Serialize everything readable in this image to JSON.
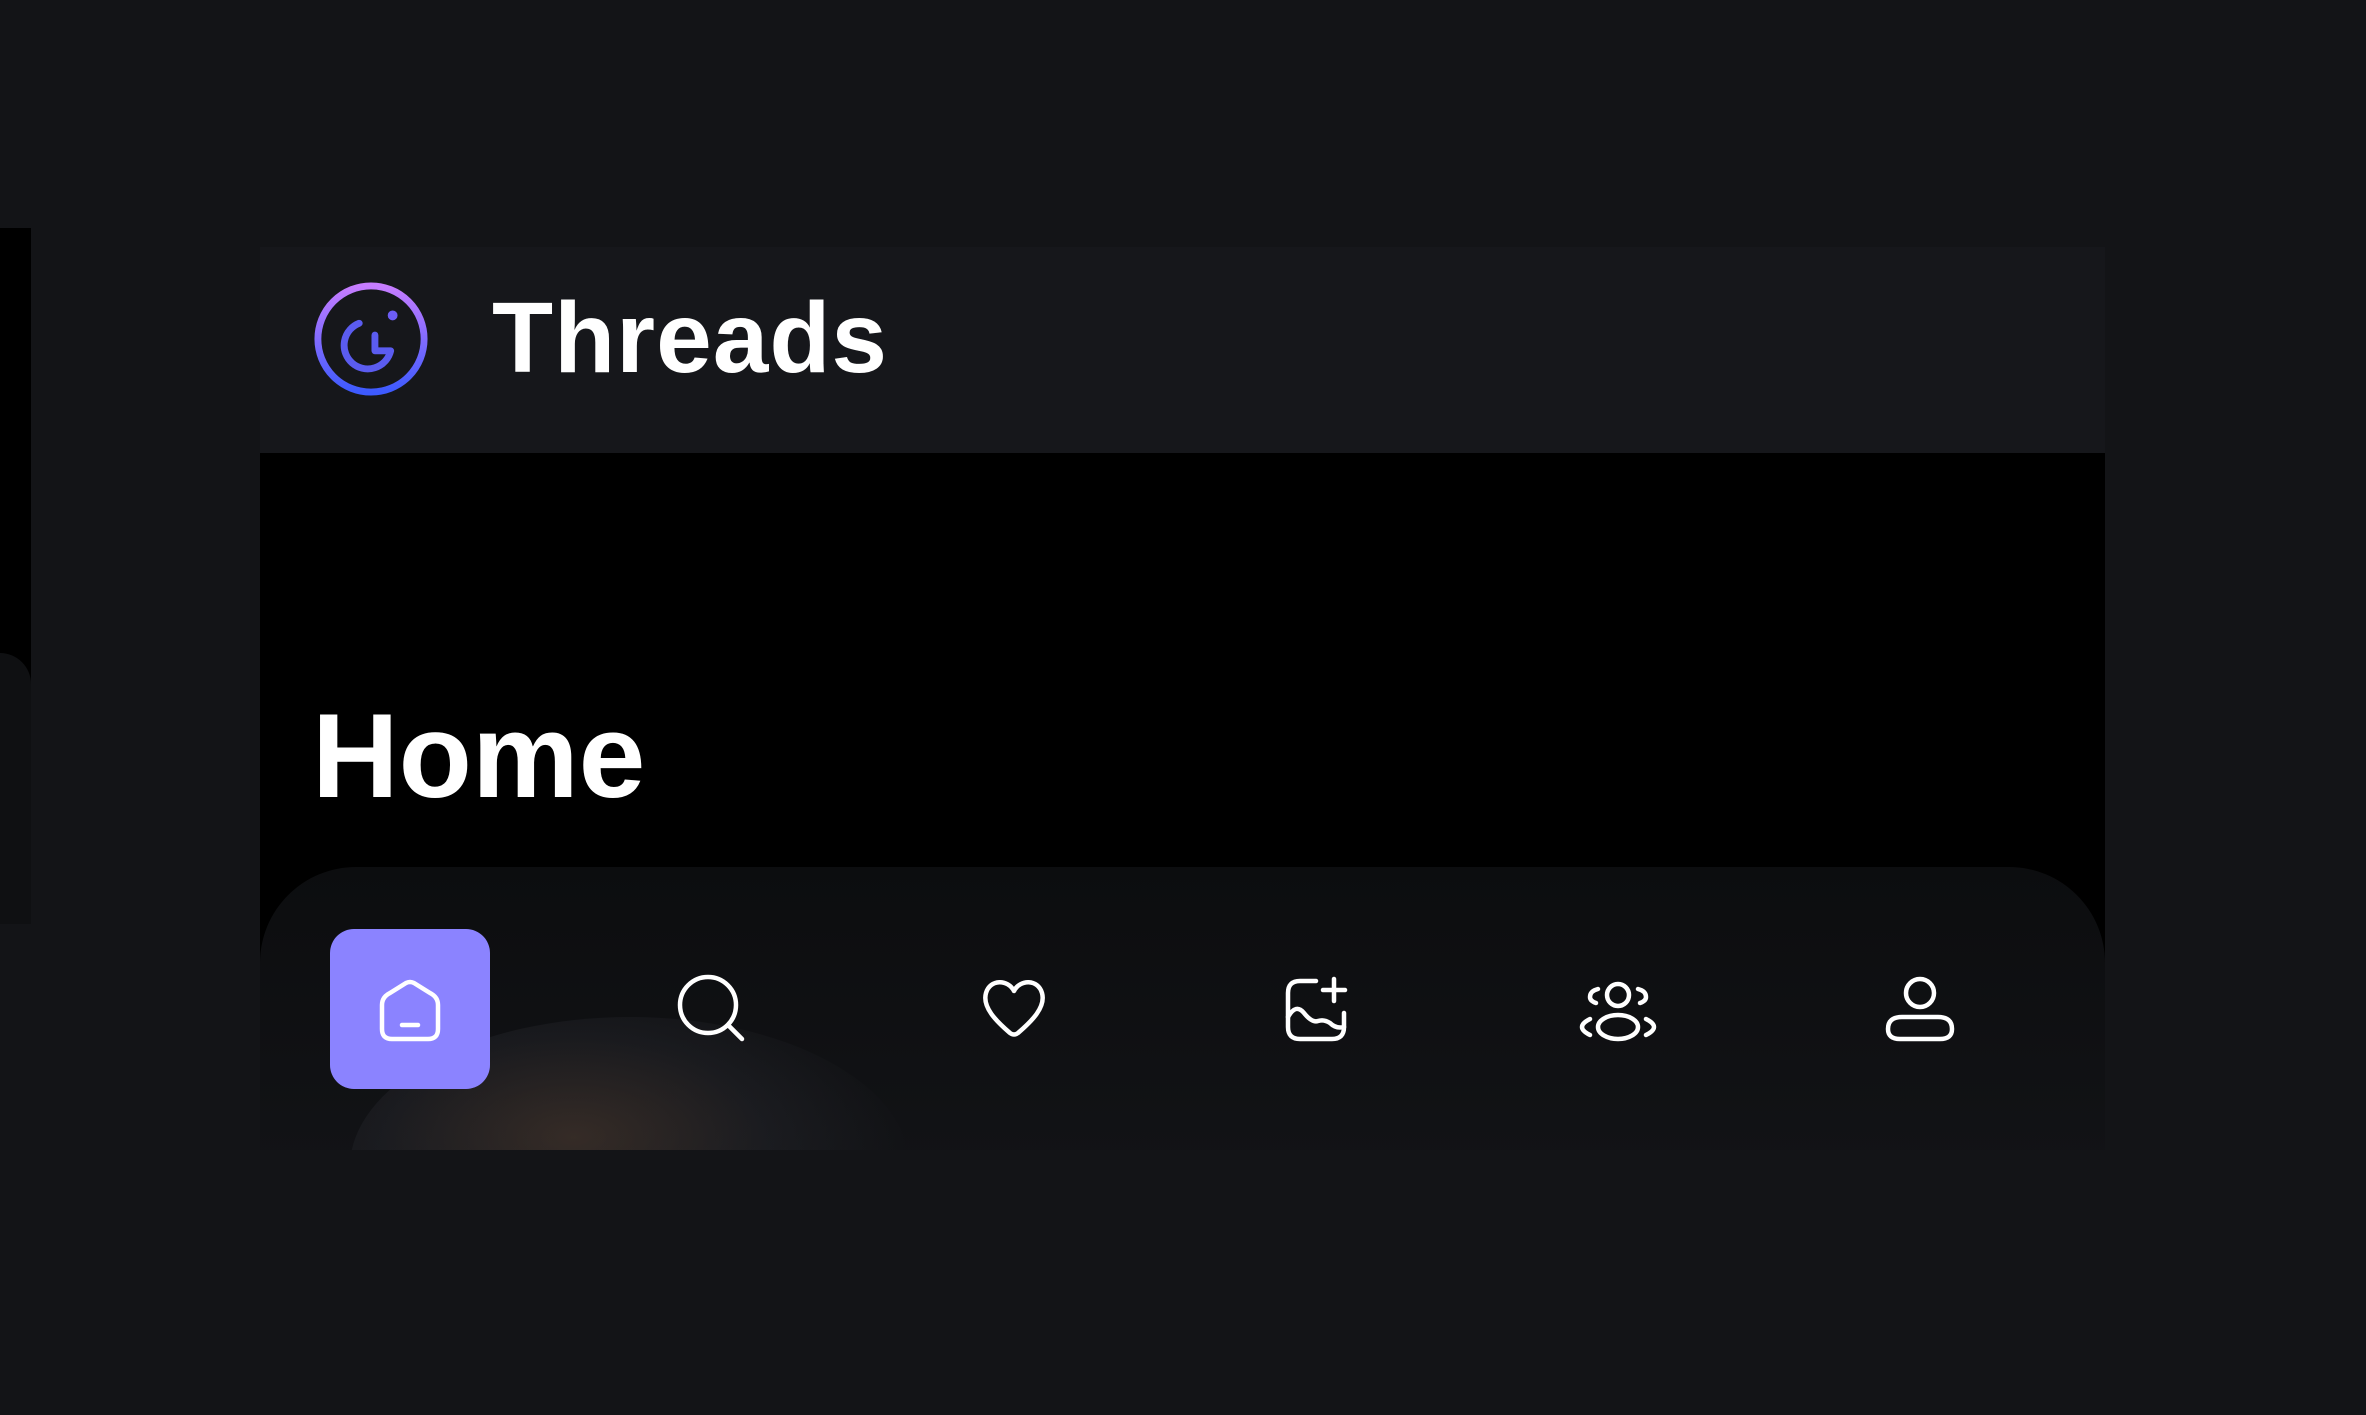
{
  "header": {
    "title": "Threads",
    "logo_icon": "threads-logo-icon",
    "logo_gradient": [
      "#c77dff",
      "#3d5afe"
    ]
  },
  "main": {
    "page_title": "Home"
  },
  "tabbar": {
    "active_color": "#8b83ff",
    "tabs": [
      {
        "icon": "home-icon",
        "active": true
      },
      {
        "icon": "search-icon",
        "active": false
      },
      {
        "icon": "heart-icon",
        "active": false
      },
      {
        "icon": "add-image-icon",
        "active": false
      },
      {
        "icon": "people-icon",
        "active": false
      },
      {
        "icon": "profile-icon",
        "active": false
      }
    ]
  }
}
